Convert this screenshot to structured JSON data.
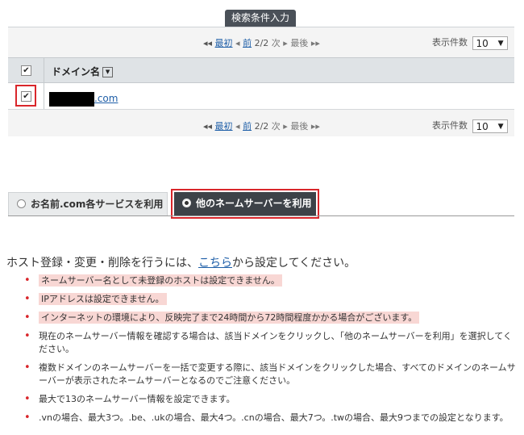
{
  "search_tab": {
    "label": "検索条件入力"
  },
  "pager": {
    "first_label": "最初",
    "prev_label": "前",
    "page_info": "2/2",
    "next_label": "次",
    "last_label": "最後",
    "count_label": "表示件数",
    "count_value": "10"
  },
  "table": {
    "header_label": "ドメイン名",
    "header_checked": true,
    "rows": [
      {
        "domain_suffix": ".com",
        "checked": true
      }
    ]
  },
  "tabs": [
    {
      "label": "お名前.com各サービスを利用",
      "active": false
    },
    {
      "label": "他のネームサーバーを利用",
      "active": true
    }
  ],
  "host": {
    "prefix": "ホスト登録・変更・削除を行うには、",
    "link": "こちら",
    "suffix": "から設定してください。"
  },
  "notes": [
    {
      "text": "ネームサーバー名として未登録のホストは設定できません。",
      "highlight": true
    },
    {
      "text": "IPアドレスは設定できません。",
      "highlight": true
    },
    {
      "text": "インターネットの環境により、反映完了まで24時間から72時間程度かかる場合がございます。",
      "highlight": true
    },
    {
      "text": "現在のネームサーバー情報を確認する場合は、該当ドメインをクリックし、「他のネームサーバーを利用」を選択してください。",
      "highlight": false
    },
    {
      "text": "複数ドメインのネームサーバーを一括で変更する際に、該当ドメインをクリックした場合、すべてのドメインのネームサーバーが表示されたネームサーバーとなるのでご注意ください。",
      "highlight": false
    },
    {
      "text": "最大で13のネームサーバー情報を設定できます。",
      "highlight": false
    },
    {
      "text": ".vnの場合、最大3つ。.be、.ukの場合、最大4つ。.cnの場合、最大7つ。.twの場合、最大9つまでの設定となります。",
      "highlight": false
    }
  ],
  "colors": {
    "accent_red": "#d9262b",
    "link_blue": "#1f5fa8",
    "dark_tab": "#3d4248",
    "highlight": "#f8d7d4"
  }
}
